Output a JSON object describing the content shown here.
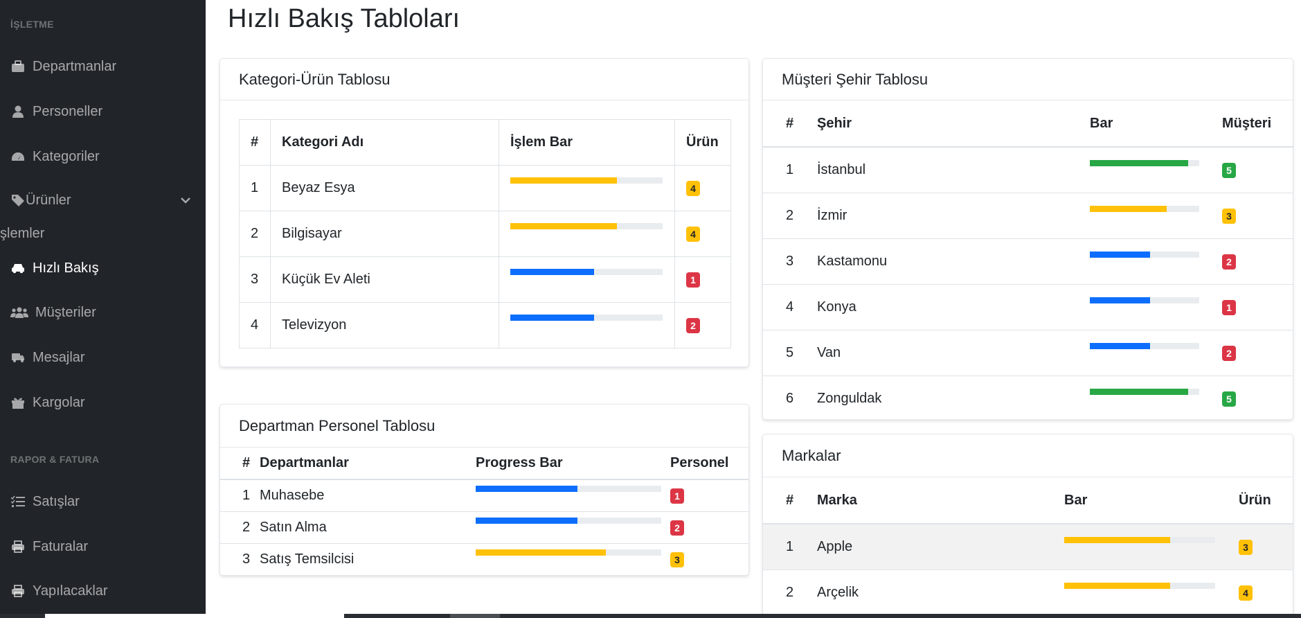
{
  "sidebar": {
    "heading_isletme": "İŞLETME",
    "heading_rapor": "RAPOR & FATURA",
    "section_cut": "şlemler",
    "items": [
      {
        "label": "Departmanlar",
        "icon": "briefcase-icon"
      },
      {
        "label": "Personeller",
        "icon": "user-icon"
      },
      {
        "label": "Kategoriler",
        "icon": "gauge-icon"
      },
      {
        "label": "Ürünler",
        "icon": "tag-icon"
      },
      {
        "label": "Hızlı Bakış",
        "icon": "car-icon"
      },
      {
        "label": "Müşteriler",
        "icon": "users-icon"
      },
      {
        "label": "Mesajlar",
        "icon": "truck-icon"
      },
      {
        "label": "Kargolar",
        "icon": "gift-icon"
      },
      {
        "label": "Satışlar",
        "icon": "list-check-icon"
      },
      {
        "label": "Faturalar",
        "icon": "print-icon"
      },
      {
        "label": "Yapılacaklar",
        "icon": "print-icon"
      }
    ]
  },
  "page_title": "Hızlı Bakış Tabloları",
  "kategori": {
    "title": "Kategori-Ürün Tablosu",
    "headers": [
      "#",
      "Kategori Adı",
      "İşlem Bar",
      "Ürün"
    ],
    "rows": [
      {
        "no": "1",
        "name": "Beyaz Esya",
        "progress": 0.7,
        "color": "warning",
        "count": "4"
      },
      {
        "no": "2",
        "name": "Bilgisayar",
        "progress": 0.7,
        "color": "warning",
        "count": "4"
      },
      {
        "no": "3",
        "name": "Küçük Ev Aleti",
        "progress": 0.55,
        "color": "primary",
        "count": "1"
      },
      {
        "no": "4",
        "name": "Televizyon",
        "progress": 0.55,
        "color": "primary",
        "count": "2"
      }
    ],
    "badge_colors": [
      "warning",
      "warning",
      "danger",
      "danger"
    ]
  },
  "departman": {
    "title": "Departman Personel Tablosu",
    "headers": [
      "#",
      "Departmanlar",
      "Progress Bar",
      "Personel"
    ],
    "rows": [
      {
        "no": "1",
        "name": "Muhasebe",
        "progress": 0.55,
        "color": "primary",
        "count": "1",
        "badge": "danger"
      },
      {
        "no": "2",
        "name": "Satın Alma",
        "progress": 0.55,
        "color": "primary",
        "count": "2",
        "badge": "danger"
      },
      {
        "no": "3",
        "name": "Satış Temsilcisi",
        "progress": 0.7,
        "color": "warning",
        "count": "3",
        "badge": "warning"
      }
    ]
  },
  "musteri": {
    "title": "Müşteri Şehir Tablosu",
    "headers": [
      "#",
      "Şehir",
      "Bar",
      "Müşteri"
    ],
    "rows": [
      {
        "no": "1",
        "name": "İstanbul",
        "progress": 0.9,
        "color": "success",
        "count": "5",
        "badge": "success"
      },
      {
        "no": "2",
        "name": "İzmir",
        "progress": 0.7,
        "color": "warning",
        "count": "3",
        "badge": "warning"
      },
      {
        "no": "3",
        "name": "Kastamonu",
        "progress": 0.55,
        "color": "primary",
        "count": "2",
        "badge": "danger"
      },
      {
        "no": "4",
        "name": "Konya",
        "progress": 0.55,
        "color": "primary",
        "count": "1",
        "badge": "danger"
      },
      {
        "no": "5",
        "name": "Van",
        "progress": 0.55,
        "color": "primary",
        "count": "2",
        "badge": "danger"
      },
      {
        "no": "6",
        "name": "Zonguldak",
        "progress": 0.9,
        "color": "success",
        "count": "5",
        "badge": "success"
      }
    ]
  },
  "markalar": {
    "title": "Markalar",
    "headers": [
      "#",
      "Marka",
      "Bar",
      "Ürün"
    ],
    "rows": [
      {
        "no": "1",
        "name": "Apple",
        "progress": 0.7,
        "color": "warning",
        "count": "3",
        "badge": "warning"
      },
      {
        "no": "2",
        "name": "Arçelik",
        "progress": 0.7,
        "color": "warning",
        "count": "4",
        "badge": "warning"
      }
    ]
  },
  "colors": {
    "sidebar_bg": "#212529",
    "warning": "#ffc107",
    "primary": "#0d6efd",
    "success": "#28a745",
    "danger": "#dc3545"
  }
}
